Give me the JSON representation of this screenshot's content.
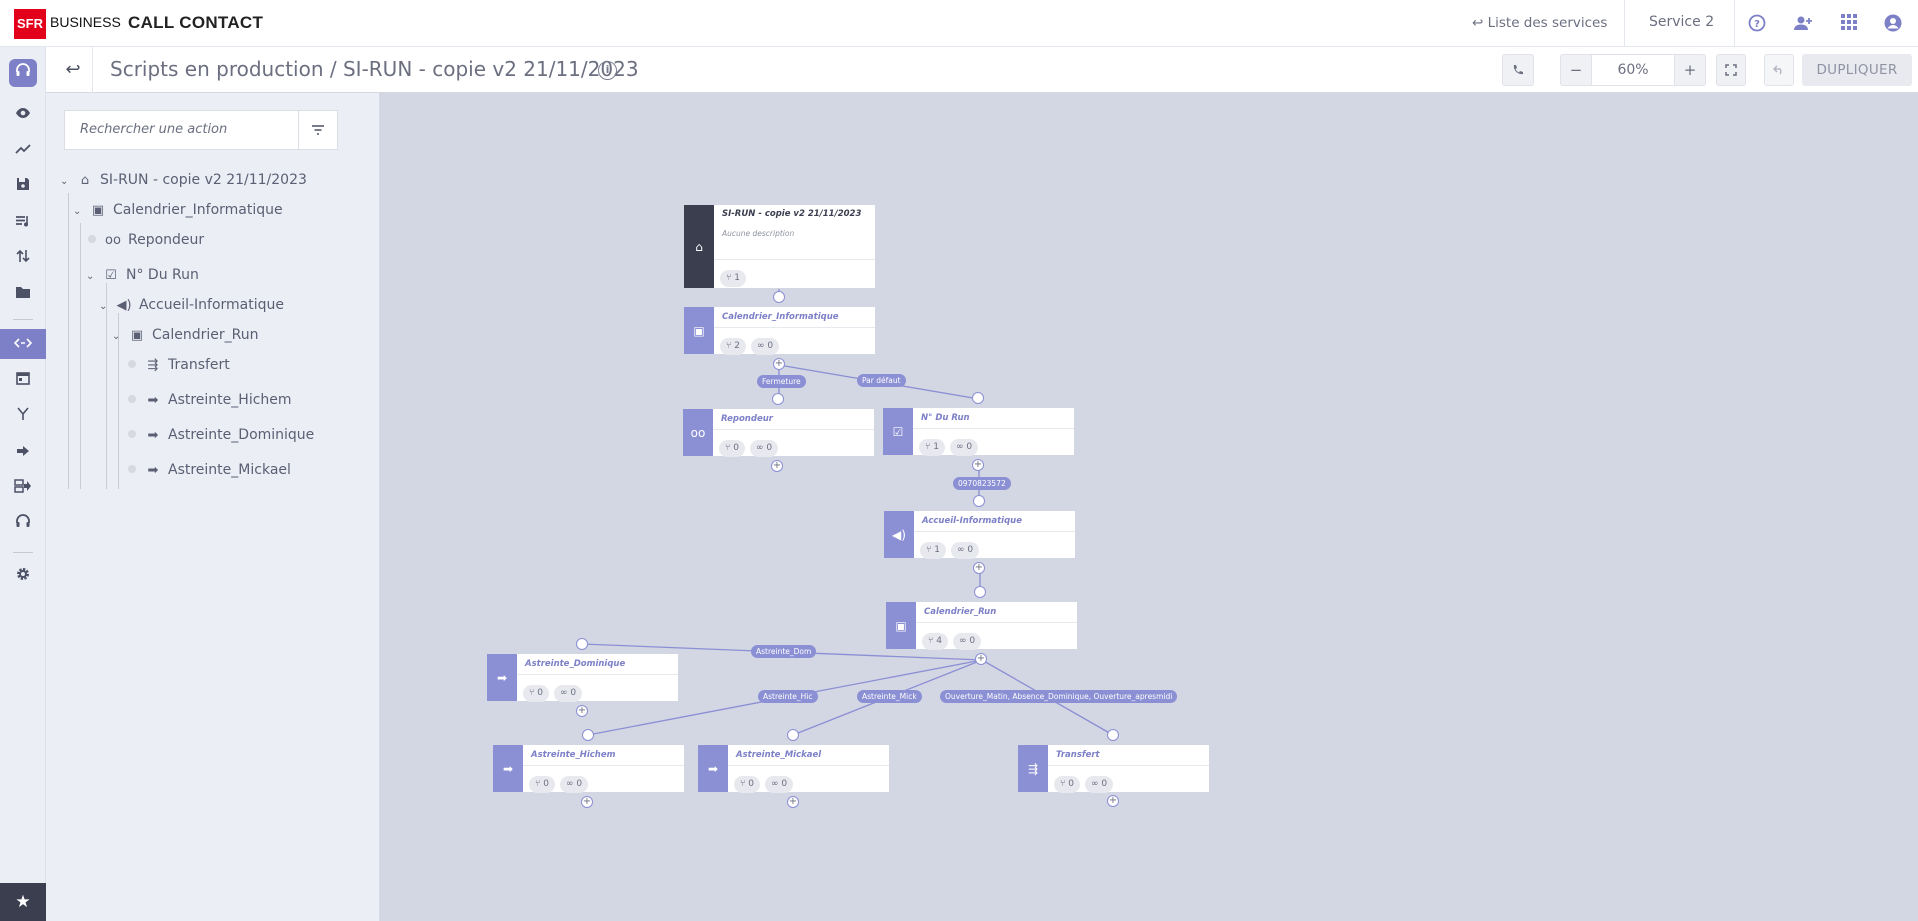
{
  "header": {
    "brand": "SFR",
    "brand_suffix": "BUSINESS",
    "app_name": "CALL CONTACT",
    "services_link": "↩ Liste des services",
    "service_name": "Service 2"
  },
  "toolbar": {
    "breadcrumb": "Scripts en production / SI-RUN - copie v2 21/11/2023",
    "info_label": "i",
    "zoom_level": "60%",
    "zoom_out": "−",
    "zoom_in": "+",
    "duplicate_label": "DUPLIQUER"
  },
  "search": {
    "placeholder": "Rechercher une action"
  },
  "tree": [
    {
      "label": "SI-RUN - copie v2 21/11/2023",
      "icon": "home-icon"
    },
    {
      "label": "Calendrier_Informatique",
      "icon": "calendar-icon"
    },
    {
      "label": "Repondeur",
      "icon": "voicemail-icon"
    },
    {
      "label": "N° Du Run",
      "icon": "check-box-icon"
    },
    {
      "label": "Accueil-Informatique",
      "icon": "speaker-icon"
    },
    {
      "label": "Calendrier_Run",
      "icon": "calendar-icon"
    },
    {
      "label": "Transfert",
      "icon": "transfer-icon"
    },
    {
      "label": "Astreinte_Hichem",
      "icon": "arrow-right-icon"
    },
    {
      "label": "Astreinte_Dominique",
      "icon": "arrow-right-icon"
    },
    {
      "label": "Astreinte_Mickael",
      "icon": "arrow-right-icon"
    }
  ],
  "flow": {
    "root": {
      "title": "SI-RUN - copie v2 21/11/2023",
      "description": "Aucune description",
      "branches": "1"
    },
    "nodes": [
      {
        "id": "cal_info",
        "title": "Calendrier_Informatique",
        "icon": "calendar-icon",
        "branches": "2",
        "links": "0"
      },
      {
        "id": "repondeur",
        "title": "Repondeur",
        "icon": "voicemail-icon",
        "branches": "0",
        "links": "0"
      },
      {
        "id": "ndurun",
        "title": "N° Du Run",
        "icon": "check-box-icon",
        "branches": "1",
        "links": "0"
      },
      {
        "id": "accueil",
        "title": "Accueil-Informatique",
        "icon": "speaker-icon",
        "branches": "1",
        "links": "0"
      },
      {
        "id": "cal_run",
        "title": "Calendrier_Run",
        "icon": "calendar-icon",
        "branches": "4",
        "links": "0"
      },
      {
        "id": "ast_dom",
        "title": "Astreinte_Dominique",
        "icon": "arrow-right-icon",
        "branches": "0",
        "links": "0"
      },
      {
        "id": "ast_hic",
        "title": "Astreinte_Hichem",
        "icon": "arrow-right-icon",
        "branches": "0",
        "links": "0"
      },
      {
        "id": "ast_mick",
        "title": "Astreinte_Mickael",
        "icon": "arrow-right-icon",
        "branches": "0",
        "links": "0"
      },
      {
        "id": "transfert",
        "title": "Transfert",
        "icon": "transfer-icon",
        "branches": "0",
        "links": "0"
      }
    ],
    "edge_labels": {
      "fermeture": "Fermeture",
      "par_defaut": "Par défaut",
      "phone": "0970823572",
      "astreinte_dom": "Astreinte_Dom",
      "astreinte_hic": "Astreinte_Hic",
      "astreinte_mick": "Astreinte_Mick",
      "ouverture": "Ouverture_Matin, Absence_Dominique, Ouverture_apresmidi"
    }
  },
  "colors": {
    "accent": "#7d80c7",
    "node_side": "#8b8fd4",
    "root_side": "#3b3e4f",
    "brand_red": "#e2001a",
    "canvas_bg": "#d3d6e3"
  }
}
